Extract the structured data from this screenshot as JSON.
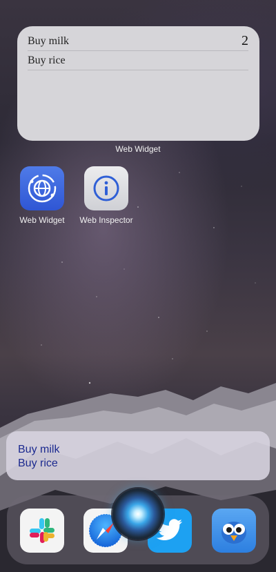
{
  "widget": {
    "rows": [
      {
        "text": "Buy milk",
        "count": "2"
      },
      {
        "text": "Buy rice",
        "count": ""
      }
    ],
    "caption": "Web Widget"
  },
  "apps": [
    {
      "label": "Web Widget",
      "icon": "globe-icon"
    },
    {
      "label": "Web Inspector",
      "icon": "info-icon"
    }
  ],
  "siri_snippet": {
    "lines": [
      "Buy milk",
      "Buy rice"
    ]
  },
  "dock": {
    "apps": [
      {
        "name": "Slack",
        "icon": "slack-icon"
      },
      {
        "name": "Safari",
        "icon": "safari-icon"
      },
      {
        "name": "Twitter",
        "icon": "twitter-icon"
      },
      {
        "name": "Tweetbot",
        "icon": "tweetbot-icon"
      }
    ]
  },
  "colors": {
    "widget_bg": "#d6d5d9",
    "snippet_text": "#1c2a8f",
    "web_widget_icon": "#3b66de",
    "twitter": "#1da1f2"
  }
}
